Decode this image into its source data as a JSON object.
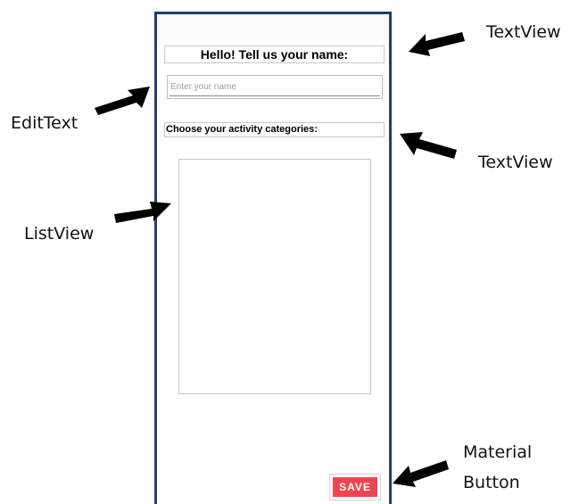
{
  "screen": {
    "title_label": "Hello! Tell us your name:",
    "name_input": {
      "placeholder": "Enter your name",
      "value": ""
    },
    "categories_label": "Choose your activity categories:",
    "categories_list": [],
    "save_button_label": "SAVE"
  },
  "annotations": {
    "textview_top": "TextView",
    "edittext": "EditText",
    "textview_mid": "TextView",
    "listview": "ListView",
    "material_button_line1": "Material",
    "material_button_line2": "Button"
  },
  "colors": {
    "phone_frame": "#1f3f6e",
    "save_button": "#ef4550",
    "annotation_arrow": "#000000"
  },
  "icons": {
    "arrow": "arrow-icon"
  }
}
